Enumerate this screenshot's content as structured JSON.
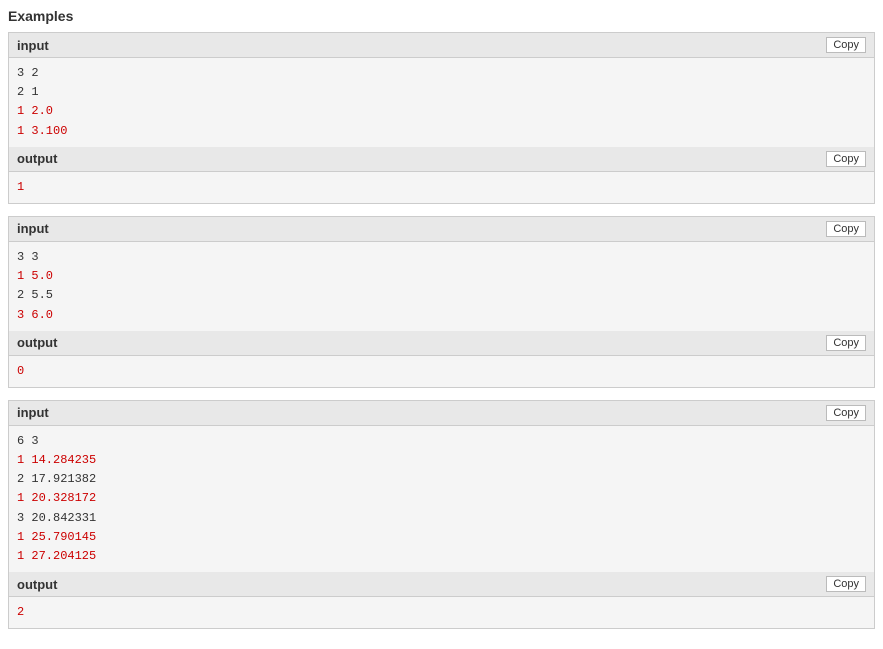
{
  "title": "Examples",
  "examples": [
    {
      "input": {
        "label": "input",
        "lines": [
          {
            "text": "3 2",
            "color": "black"
          },
          {
            "text": "2 1",
            "color": "black"
          },
          {
            "text": "1 2.0",
            "color": "red"
          },
          {
            "text": "1 3.100",
            "color": "red"
          }
        ]
      },
      "output": {
        "label": "output",
        "lines": [
          {
            "text": "1",
            "color": "red"
          }
        ]
      }
    },
    {
      "input": {
        "label": "input",
        "lines": [
          {
            "text": "3 3",
            "color": "black"
          },
          {
            "text": "1 5.0",
            "color": "red"
          },
          {
            "text": "2 5.5",
            "color": "black"
          },
          {
            "text": "3 6.0",
            "color": "red"
          }
        ]
      },
      "output": {
        "label": "output",
        "lines": [
          {
            "text": "0",
            "color": "red"
          }
        ]
      }
    },
    {
      "input": {
        "label": "input",
        "lines": [
          {
            "text": "6 3",
            "color": "black"
          },
          {
            "text": "1 14.284235",
            "color": "red"
          },
          {
            "text": "2 17.921382",
            "color": "black"
          },
          {
            "text": "1 20.328172",
            "color": "red"
          },
          {
            "text": "3 20.842331",
            "color": "black"
          },
          {
            "text": "1 25.790145",
            "color": "red"
          },
          {
            "text": "1 27.204125",
            "color": "red"
          }
        ]
      },
      "output": {
        "label": "output",
        "lines": [
          {
            "text": "2",
            "color": "red"
          }
        ]
      }
    }
  ],
  "copy_label": "Copy"
}
